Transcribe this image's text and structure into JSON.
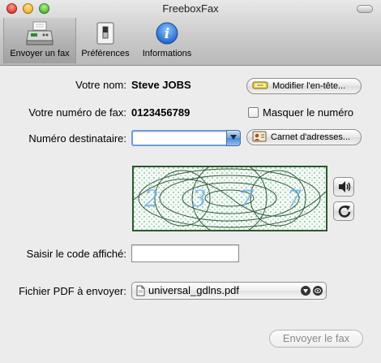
{
  "window": {
    "title": "FreeboxFax"
  },
  "toolbar": {
    "items": [
      {
        "label": "Envoyer un fax",
        "selected": true
      },
      {
        "label": "Préférences"
      },
      {
        "label": "Informations"
      }
    ]
  },
  "form": {
    "name_label": "Votre nom:",
    "name_value": "Steve JOBS",
    "edit_header_button": "Modifier l'en-tête...",
    "fax_label": "Votre numéro de fax:",
    "fax_value": "0123456789",
    "hide_number_label": "Masquer le numéro",
    "hide_number_checked": false,
    "recipient_label": "Numéro destinataire:",
    "recipient_value": "",
    "address_book_button": "Carnet d'adresses...",
    "captcha_text": "2 3 7 7",
    "code_label": "Saisir le code affiché:",
    "code_value": "",
    "pdf_label": "Fichier PDF à envoyer:",
    "pdf_file": "universal_gdlns.pdf",
    "send_button": "Envoyer le fax"
  },
  "icons": {
    "toolbar_send": "fax-machine-icon",
    "toolbar_prefs": "switch-panel-icon",
    "toolbar_info": "info-icon",
    "edit_header": "pencil-icon",
    "address_book": "address-card-icon",
    "audio": "speaker-icon",
    "refresh": "refresh-icon",
    "file": "document-icon"
  }
}
